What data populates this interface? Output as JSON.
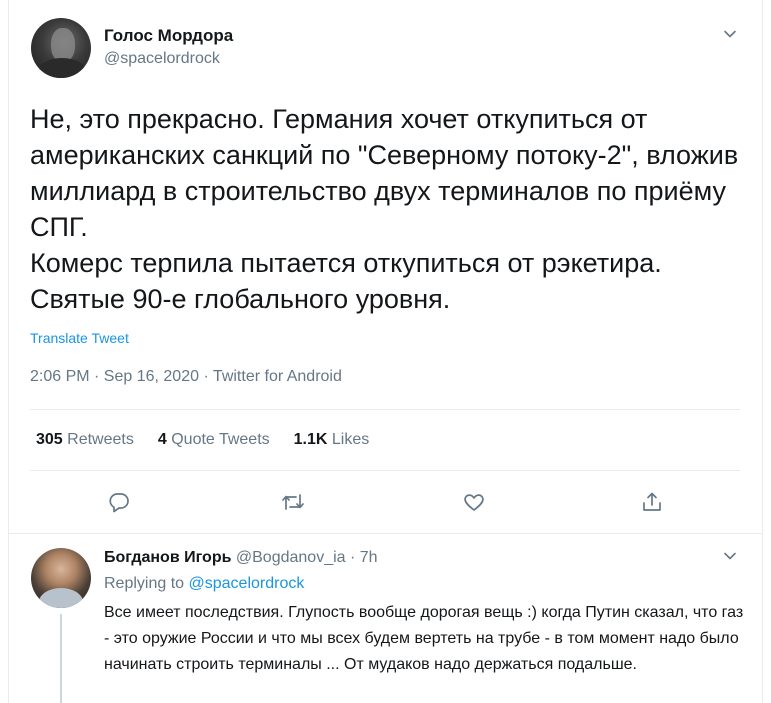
{
  "tweet": {
    "author_name": "Голос Мордора",
    "author_handle": "@spacelordrock",
    "text": "Не, это прекрасно. Германия хочет откупиться от американских санкций по \"Северному потоку-2\", вложив миллиард в строительство двух терминалов по приёму СПГ.\nКомерс терпила пытается откупиться от рэкетира. Святые 90-е глобального уровня.",
    "translate_label": "Translate Tweet",
    "timestamp": "2:06 PM · Sep 16, 2020 · Twitter for Android",
    "stats": [
      {
        "count": "305",
        "label": "Retweets"
      },
      {
        "count": "4",
        "label": "Quote Tweets"
      },
      {
        "count": "1.1K",
        "label": "Likes"
      }
    ],
    "actions": [
      "reply-icon",
      "retweet-icon",
      "like-icon",
      "share-icon"
    ]
  },
  "reply": {
    "author_name": "Богданов Игорь",
    "author_handle": "@Bogdanov_ia",
    "separator": "·",
    "time": "7h",
    "replying_prefix": "Replying to",
    "replying_to": "@spacelordrock",
    "text": "Все имеет последствия. Глупость вообще дорогая вещь :) когда Путин сказал, что газ - это оружие России и что мы всех будем вертеть на трубе - в том момент надо было начинать строить терминалы ... От мудаков надо держаться подальше."
  },
  "colors": {
    "text": "#14171a",
    "muted": "#657786",
    "link": "#1b95e0",
    "border": "#e6ecf0"
  }
}
